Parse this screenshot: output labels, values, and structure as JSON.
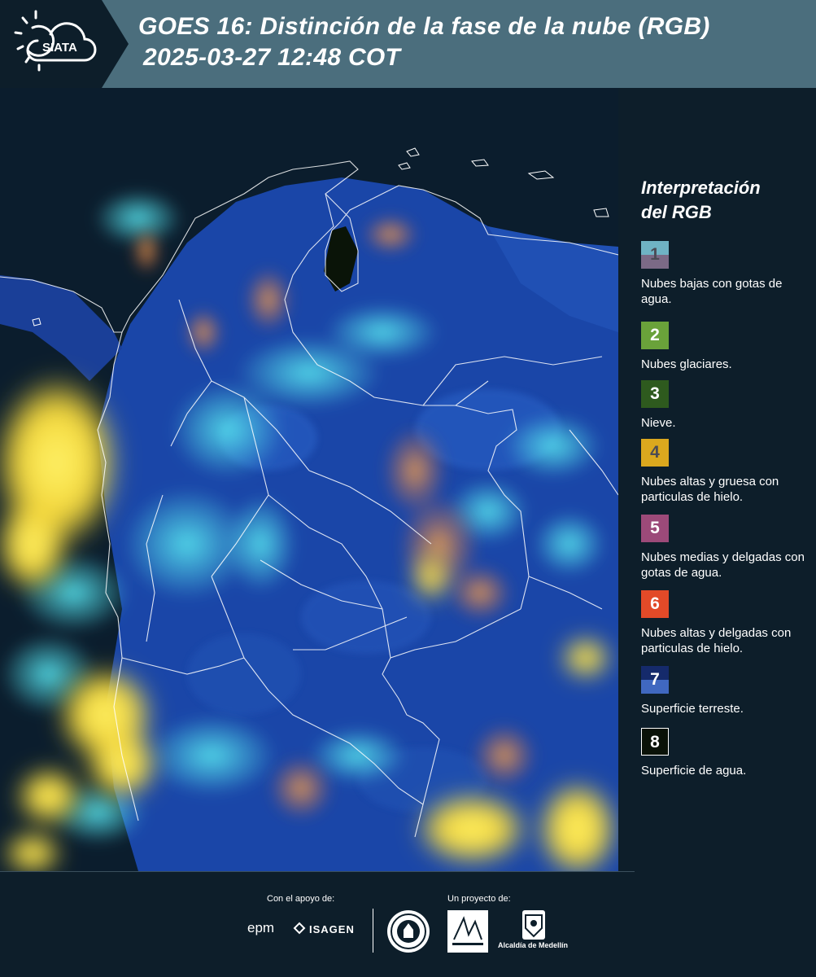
{
  "header": {
    "logo_text": "SIATA",
    "title_line1": "GOES 16: Distinción de la fase de la nube (RGB)",
    "title_line2": "2025-03-27 12:48 COT"
  },
  "legend": {
    "title_line1": "Interpretación",
    "title_line2": "del RGB",
    "items": [
      {
        "num": "1",
        "label": "Nubes bajas con gotas de agua.",
        "color_top": "#6fb3c4",
        "color_bottom": "#7b6a86"
      },
      {
        "num": "2",
        "label": "Nubes glaciares.",
        "color_top": "#6aa23a",
        "color_bottom": "#6aa23a"
      },
      {
        "num": "3",
        "label": "Nieve.",
        "color_top": "#2e5a1e",
        "color_bottom": "#2e5a1e"
      },
      {
        "num": "4",
        "label": "Nubes altas y gruesa con particulas de hielo.",
        "color_top": "#dba81e",
        "color_bottom": "#dba81e"
      },
      {
        "num": "5",
        "label": "Nubes medias y delgadas con gotas de agua.",
        "color_top": "#9c4a79",
        "color_bottom": "#9c4a79"
      },
      {
        "num": "6",
        "label": "Nubes altas y delgadas con particulas de hielo.",
        "color_top": "#e24a28",
        "color_bottom": "#e24a28"
      },
      {
        "num": "7",
        "label": "Superficie terreste.",
        "color_top": "#152a6b",
        "color_bottom": "#4068c0"
      },
      {
        "num": "8",
        "label": "Superficie de agua.",
        "color_top": "#0a1208",
        "color_bottom": "#0a1208"
      }
    ]
  },
  "footer": {
    "support_caption": "Con el apoyo de:",
    "project_caption": "Un proyecto de:",
    "sponsor_1": "epm",
    "sponsor_2": "ISAGEN",
    "partner_3": "Alcaldía de Medellín"
  }
}
